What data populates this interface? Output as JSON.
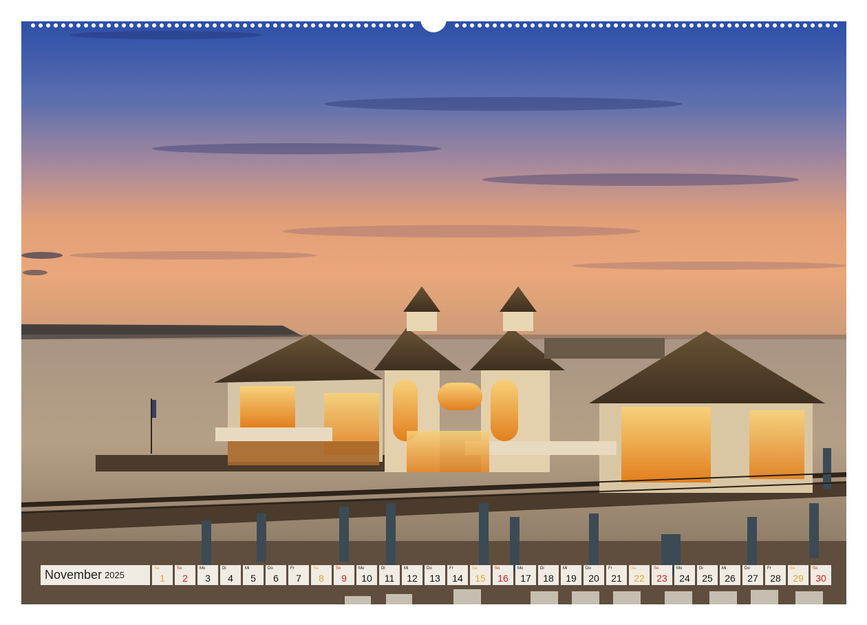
{
  "calendar": {
    "month": "November",
    "year": "2025",
    "days": [
      {
        "wd": "Sa",
        "num": "1",
        "type": "sat"
      },
      {
        "wd": "So",
        "num": "2",
        "type": "sun"
      },
      {
        "wd": "Mo",
        "num": "3",
        "type": "week"
      },
      {
        "wd": "Di",
        "num": "4",
        "type": "week"
      },
      {
        "wd": "Mi",
        "num": "5",
        "type": "week"
      },
      {
        "wd": "Do",
        "num": "6",
        "type": "week"
      },
      {
        "wd": "Fr",
        "num": "7",
        "type": "week"
      },
      {
        "wd": "Sa",
        "num": "8",
        "type": "sat"
      },
      {
        "wd": "So",
        "num": "9",
        "type": "sun"
      },
      {
        "wd": "Mo",
        "num": "10",
        "type": "week"
      },
      {
        "wd": "Di",
        "num": "11",
        "type": "week"
      },
      {
        "wd": "Mi",
        "num": "12",
        "type": "week"
      },
      {
        "wd": "Do",
        "num": "13",
        "type": "week"
      },
      {
        "wd": "Fr",
        "num": "14",
        "type": "week"
      },
      {
        "wd": "Sa",
        "num": "15",
        "type": "sat"
      },
      {
        "wd": "So",
        "num": "16",
        "type": "sun"
      },
      {
        "wd": "Mo",
        "num": "17",
        "type": "week"
      },
      {
        "wd": "Di",
        "num": "18",
        "type": "week"
      },
      {
        "wd": "Mi",
        "num": "19",
        "type": "week"
      },
      {
        "wd": "Do",
        "num": "20",
        "type": "week"
      },
      {
        "wd": "Fr",
        "num": "21",
        "type": "week"
      },
      {
        "wd": "Sa",
        "num": "22",
        "type": "sat"
      },
      {
        "wd": "So",
        "num": "23",
        "type": "sun"
      },
      {
        "wd": "Mo",
        "num": "24",
        "type": "week"
      },
      {
        "wd": "Di",
        "num": "25",
        "type": "week"
      },
      {
        "wd": "Mi",
        "num": "26",
        "type": "week"
      },
      {
        "wd": "Do",
        "num": "27",
        "type": "week"
      },
      {
        "wd": "Fr",
        "num": "28",
        "type": "week"
      },
      {
        "wd": "Sa",
        "num": "29",
        "type": "sat"
      },
      {
        "wd": "So",
        "num": "30",
        "type": "sun"
      }
    ]
  },
  "colors": {
    "saturday": "#e6a233",
    "sunday": "#c71f1f",
    "weekday": "#111111",
    "cell_background": "#f1ece3"
  },
  "photo": {
    "subject": "illuminated pier pavilion at dusk over the sea"
  }
}
